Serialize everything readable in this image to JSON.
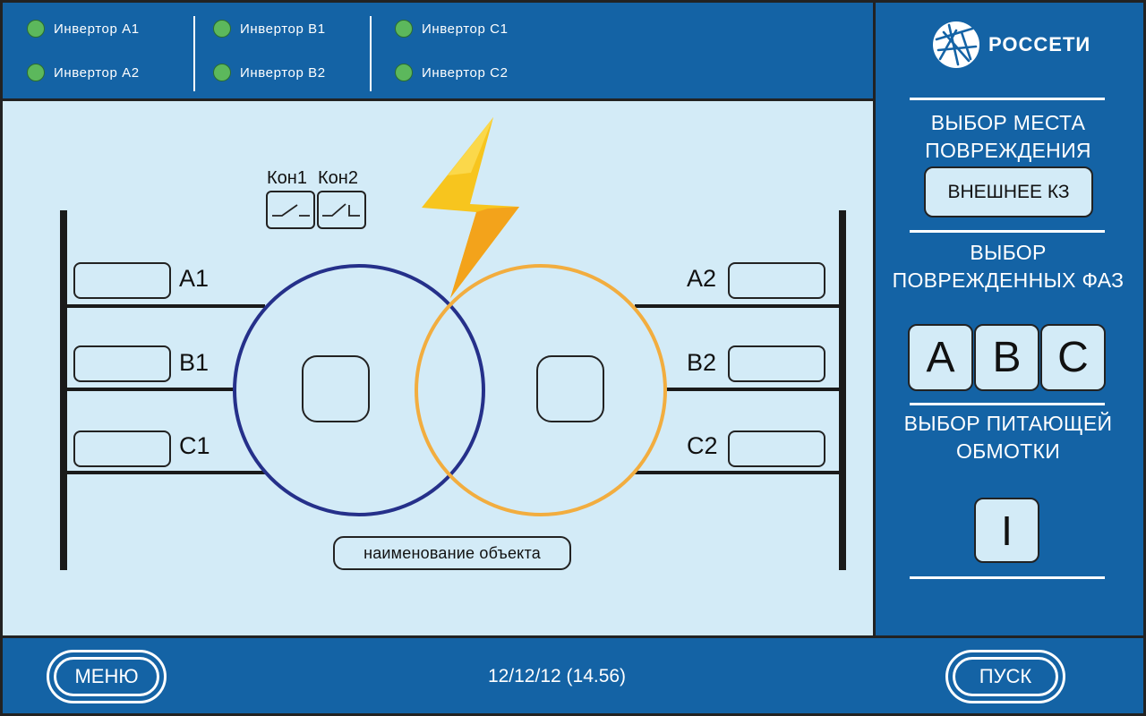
{
  "header": {
    "inverters": [
      {
        "label": "Инвертор А1"
      },
      {
        "label": "Инвертор А2"
      },
      {
        "label": "Инвертор В1"
      },
      {
        "label": "Инвертор В2"
      },
      {
        "label": "Инвертор С1"
      },
      {
        "label": "Инвертор С2"
      }
    ],
    "led_color": "#5cb85c"
  },
  "brand": {
    "name": "РОССЕТИ"
  },
  "sidebar": {
    "fault_place": {
      "title": "ВЫБОР МЕСТА ПОВРЕЖДЕНИЯ",
      "value": "ВНЕШНЕЕ КЗ"
    },
    "damaged_phases": {
      "title": "ВЫБОР ПОВРЕЖДЕННЫХ ФАЗ",
      "phases": [
        "A",
        "B",
        "C"
      ]
    },
    "feeding_winding": {
      "title": "ВЫБОР ПИТАЮЩЕЙ ОБМОТКИ",
      "value": "I"
    }
  },
  "scheme": {
    "contacts": [
      "Кон1",
      "Кон2"
    ],
    "left_phases": [
      "А1",
      "В1",
      "С1"
    ],
    "right_phases": [
      "А2",
      "В2",
      "С2"
    ],
    "object_name": "наименование объекта",
    "colors": {
      "winding_1": "#25308a",
      "winding_2": "#f2ad3f",
      "lightning": "#f7c51e",
      "background": "#d3ebf7",
      "panel": "#1463a5"
    }
  },
  "footer": {
    "menu_label": "МЕНЮ",
    "datetime": "12/12/12 (14.56)",
    "start_label": "ПУСК"
  }
}
